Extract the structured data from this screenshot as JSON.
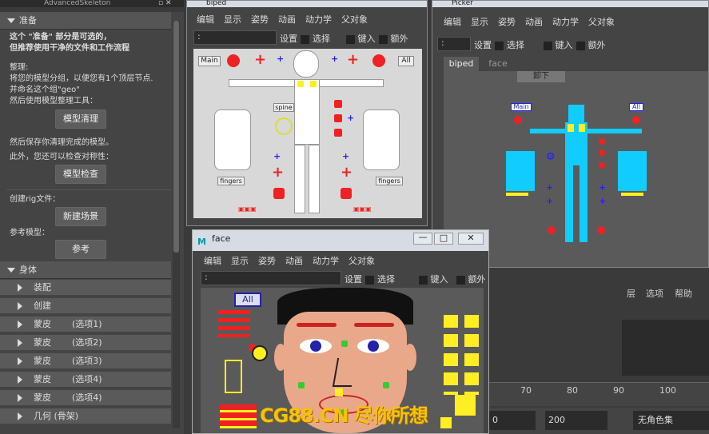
{
  "left_panel": {
    "title": "AdvancedSkeleton",
    "section_prep": "准备",
    "intro1": "这个 \"准备\" 部分是可选的，",
    "intro2": "但推荐使用干净的文件和工作流程",
    "tidy_head": "整理:",
    "tidy1": "将您的模型分组，以便您有1个顶层节点.",
    "tidy2": "并命名这个组\"geo\"",
    "tidy3": "然后使用模型整理工具：",
    "btn_clean": "模型清理",
    "save1": "然后保存你清理完成的模型。",
    "save2": "此外，您还可以检查对称性：",
    "btn_check": "模型检查",
    "create_rig": "创建rig文件：",
    "btn_new": "新建场景",
    "ref_model": "参考模型：",
    "btn_ref": "参考",
    "section_body": "身体",
    "rows": [
      {
        "label": "装配",
        "opt": ""
      },
      {
        "label": "创建",
        "opt": ""
      },
      {
        "label": "蒙皮",
        "opt": "(选项1)"
      },
      {
        "label": "蒙皮",
        "opt": "(选项2)"
      },
      {
        "label": "蒙皮",
        "opt": "(选项3)"
      },
      {
        "label": "蒙皮",
        "opt": "(选项4)"
      },
      {
        "label": "蒙皮",
        "opt": "(选项4)"
      },
      {
        "label": "几何 (骨架)",
        "opt": ""
      }
    ]
  },
  "biped": {
    "title": "biped",
    "menu": [
      "编辑",
      "显示",
      "姿势",
      "动画",
      "动力学",
      "父对象"
    ],
    "select_value": ":",
    "setup": "设置",
    "select": "选择",
    "key": "键入",
    "extra": "额外",
    "main": "Main",
    "all": "All",
    "spine": "spine",
    "fingers_l": "fingers",
    "fingers_r": "fingers"
  },
  "picker": {
    "title": "Picker",
    "menu": [
      "编辑",
      "显示",
      "姿势",
      "动画",
      "动力学",
      "父对象"
    ],
    "select_value": ":",
    "setup": "设置",
    "select": "选择",
    "key": "键入",
    "extra": "额外",
    "tab_biped": "biped",
    "tab_face": "face",
    "unload": "卸下",
    "main": "Main",
    "all": "All"
  },
  "face": {
    "title": "face",
    "menu": [
      "编辑",
      "显示",
      "姿势",
      "动画",
      "动力学",
      "父对象"
    ],
    "select_value": ":",
    "setup": "设置",
    "select": "选择",
    "key": "键入",
    "extra": "额外",
    "all": "All"
  },
  "background": {
    "menu_layer": "层",
    "menu_options": "选项",
    "menu_help": "帮助",
    "ruler": [
      "70",
      "80",
      "90",
      "100"
    ],
    "field_200": "200",
    "field_0": "0",
    "charset": "无角色集",
    "watermark": "CG88.CN 尽你所想"
  }
}
